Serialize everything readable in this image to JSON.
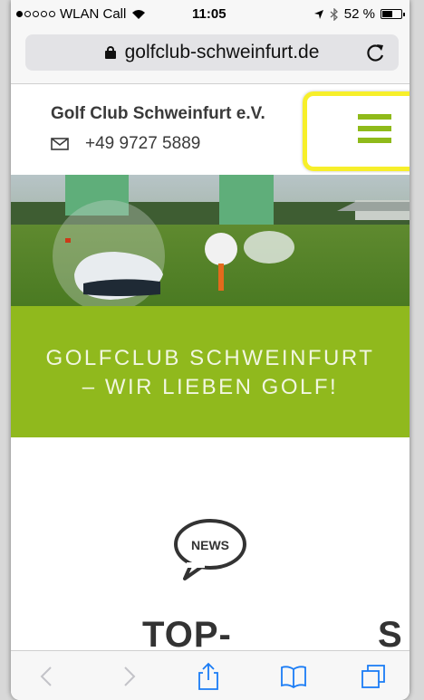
{
  "status_bar": {
    "signal_dots_filled": 1,
    "signal_dots_total": 5,
    "carrier": "WLAN Call",
    "time": "11:05",
    "battery": "52 %",
    "battery_level": 0.52
  },
  "browser": {
    "url": "golfclub-schweinfurt.de",
    "toolbar_icons": [
      "back-icon",
      "forward-icon",
      "share-icon",
      "bookmarks-icon",
      "tabs-icon"
    ]
  },
  "header": {
    "club_name": "Golf Club Schweinfurt e.V.",
    "phone": "+49 9727 5889"
  },
  "banner": {
    "line1": "GOLFCLUB SCHWEINFURT",
    "line2": "– WIR LIEBEN GOLF!"
  },
  "news": {
    "icon_label": "NEWS",
    "title": "TOP-",
    "title_right": "S"
  },
  "colors": {
    "accent_green": "#90b91d",
    "highlight_yellow": "#f7ef2a"
  }
}
